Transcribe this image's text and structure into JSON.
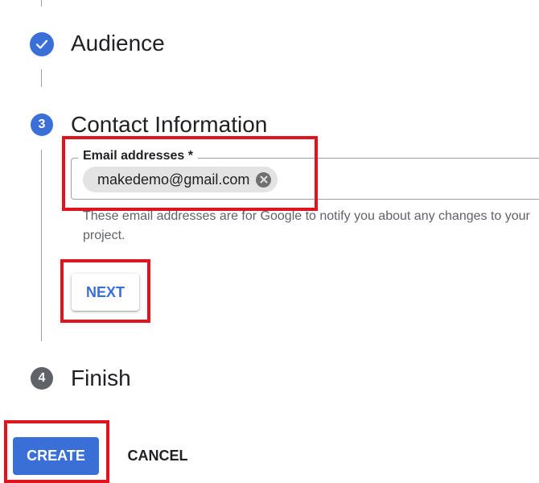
{
  "steps": {
    "audience": {
      "title": "Audience",
      "state": "completed",
      "icon": "checkmark-icon"
    },
    "contact": {
      "number": "3",
      "title": "Contact Information",
      "state": "active"
    },
    "finish": {
      "number": "4",
      "title": "Finish",
      "state": "pending"
    }
  },
  "contact_form": {
    "email_label": "Email addresses *",
    "email_chips": [
      "makedemo@gmail.com"
    ],
    "chip_remove_icon": "close-circle-icon",
    "hint": "These email addresses are for Google to notify you about any changes to your project.",
    "next_label": "NEXT"
  },
  "actions": {
    "create_label": "CREATE",
    "cancel_label": "CANCEL"
  },
  "colors": {
    "accent": "#3b6fd8",
    "step_pending": "#5f6368",
    "annotation": "#e0141e"
  }
}
